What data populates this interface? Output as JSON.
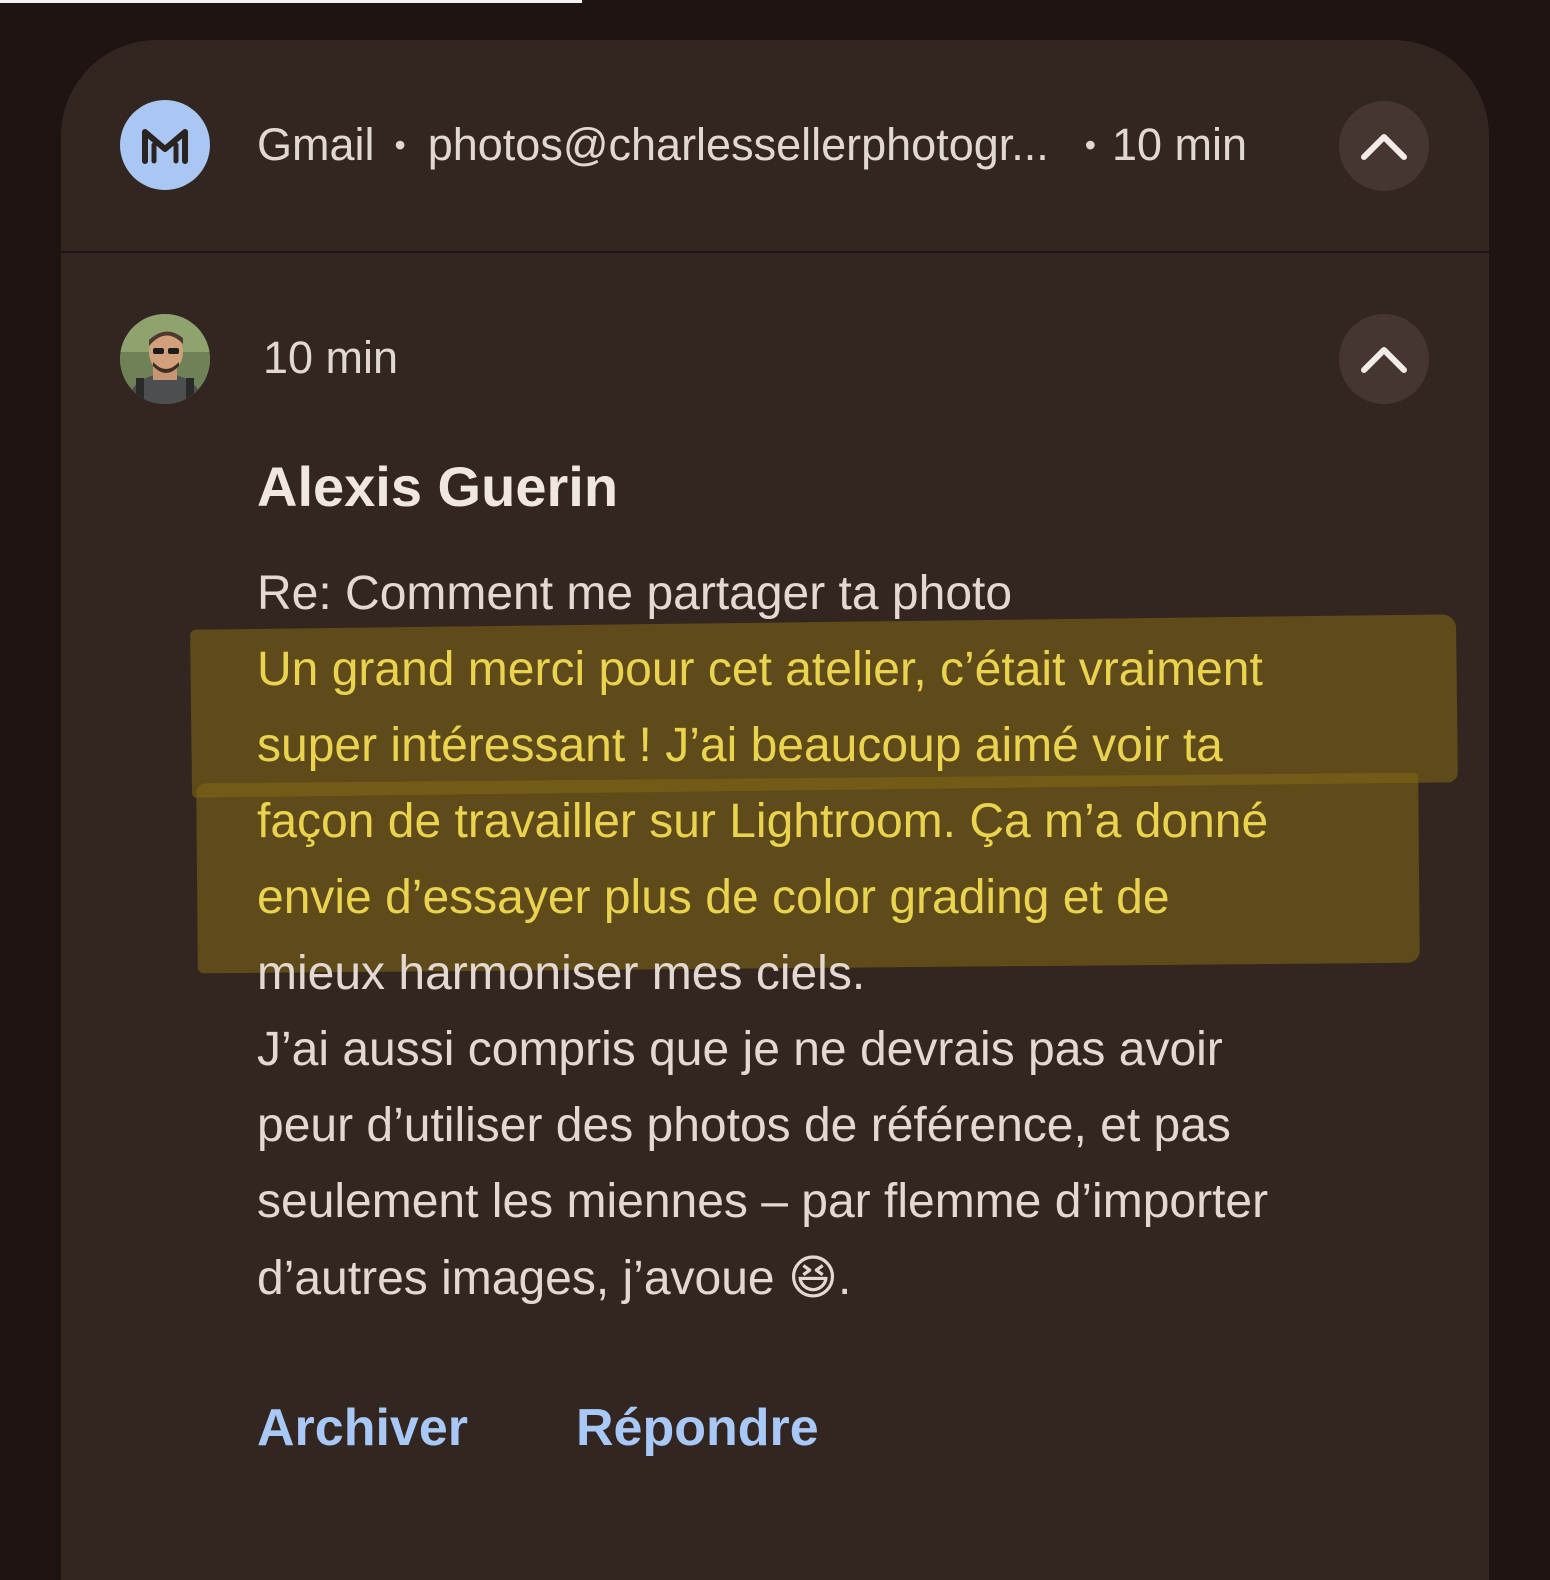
{
  "notification": {
    "app_name": "Gmail",
    "separator": "•",
    "account": "photos@charlessellerphotogr...",
    "time": "10 min",
    "app_icon": "gmail-m-icon",
    "expand_icon": "chevron-up-icon"
  },
  "message": {
    "time": "10 min",
    "sender": "Alexis Guerin",
    "subject": "Re: Comment me partager ta photo",
    "lines": [
      "Un grand merci pour cet atelier, c’était vraiment",
      "super intéressant ! J’ai beaucoup aimé voir ta",
      "façon de travailler sur Lightroom. Ça m’a donné",
      "envie d’essayer plus de color grading et de",
      "mieux harmoniser mes ciels.",
      "J’ai aussi compris que je ne devrais pas avoir",
      "peur d’utiliser des photos de référence, et pas",
      "seulement les miennes – par flemme d’importer",
      "d’autres images, j’avoue",
      "😆",
      "."
    ],
    "highlight_color": "#ead34f",
    "avatar": "profile-photo"
  },
  "actions": {
    "archive": "Archiver",
    "reply": "Répondre"
  },
  "colors": {
    "card_background": "#332620",
    "action_blue": "#a8c8f8",
    "app_icon_blue": "#a9c7f2"
  }
}
